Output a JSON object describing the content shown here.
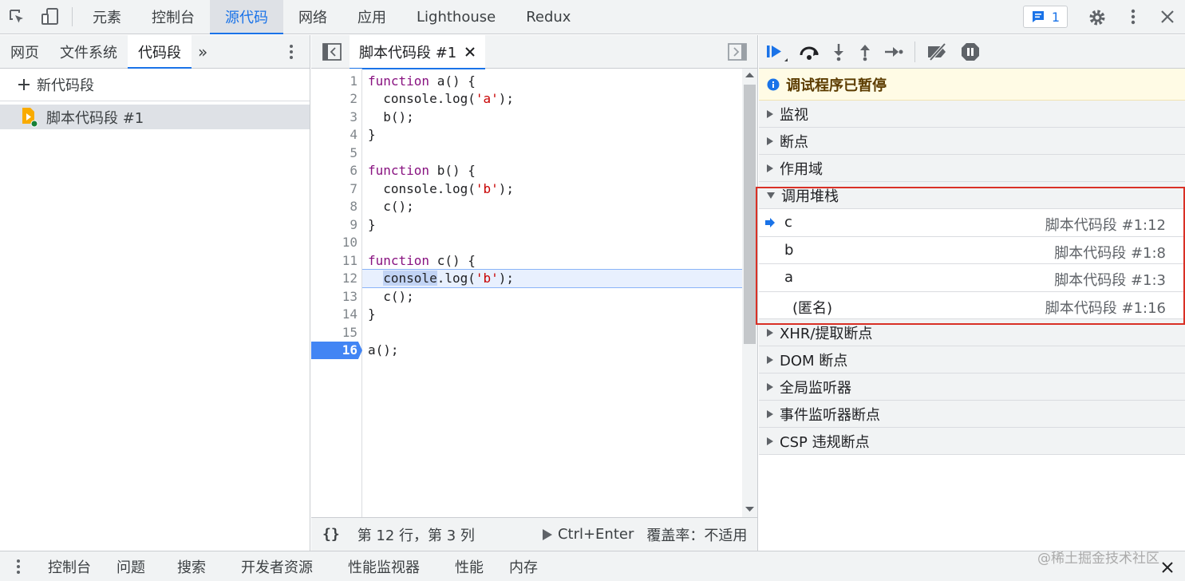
{
  "toolbar": {
    "tabs": [
      "元素",
      "控制台",
      "源代码",
      "网络",
      "应用",
      "Lighthouse",
      "Redux"
    ],
    "active_tab": "源代码",
    "issues_count": "1"
  },
  "navigator": {
    "tabs": [
      "网页",
      "文件系统",
      "代码段"
    ],
    "active_tab": "代码段",
    "new_snippet_label": "新代码段",
    "snippets": [
      "脚本代码段 #1"
    ]
  },
  "editor": {
    "tab_title": "脚本代码段 #1",
    "lines": [
      {
        "n": "1",
        "code": "function a() {"
      },
      {
        "n": "2",
        "code": "  console.log('a');"
      },
      {
        "n": "3",
        "code": "  b();"
      },
      {
        "n": "4",
        "code": "}"
      },
      {
        "n": "5",
        "code": ""
      },
      {
        "n": "6",
        "code": "function b() {"
      },
      {
        "n": "7",
        "code": "  console.log('b');"
      },
      {
        "n": "8",
        "code": "  c();"
      },
      {
        "n": "9",
        "code": "}"
      },
      {
        "n": "10",
        "code": ""
      },
      {
        "n": "11",
        "code": "function c() {"
      },
      {
        "n": "12",
        "code": "  console.log('b');"
      },
      {
        "n": "13",
        "code": "  c();"
      },
      {
        "n": "14",
        "code": "}"
      },
      {
        "n": "15",
        "code": ""
      },
      {
        "n": "16",
        "code": "a();"
      }
    ],
    "paused_line": "12",
    "breakpoint_line": "16",
    "status": {
      "position": "第 12 行，第 3 列",
      "run_label": "Ctrl+Enter",
      "coverage": "覆盖率：不适用"
    }
  },
  "debugger": {
    "paused_message": "调试程序已暂停",
    "sections_before": [
      "监视",
      "断点",
      "作用域"
    ],
    "callstack_title": "调用堆栈",
    "callstack": [
      {
        "fn": "c",
        "loc": "脚本代码段 #1:12",
        "current": true
      },
      {
        "fn": "b",
        "loc": "脚本代码段 #1:8",
        "current": false
      },
      {
        "fn": "a",
        "loc": "脚本代码段 #1:3",
        "current": false
      },
      {
        "fn": "(匿名)",
        "loc": "脚本代码段 #1:16",
        "current": false
      }
    ],
    "sections_after": [
      "XHR/提取断点",
      "DOM 断点",
      "全局监听器",
      "事件监听器断点",
      "CSP 违规断点"
    ]
  },
  "drawer": {
    "tabs": [
      "控制台",
      "问题",
      "搜索",
      "开发者资源",
      "性能监视器",
      "性能",
      "内存"
    ]
  },
  "watermark": "@稀土掘金技术社区",
  "colors": {
    "accent": "#1a73e8",
    "keyword": "#881280",
    "string": "#c80000",
    "paused_bg": "#fffbe5",
    "highlight_box": "#d93025"
  }
}
